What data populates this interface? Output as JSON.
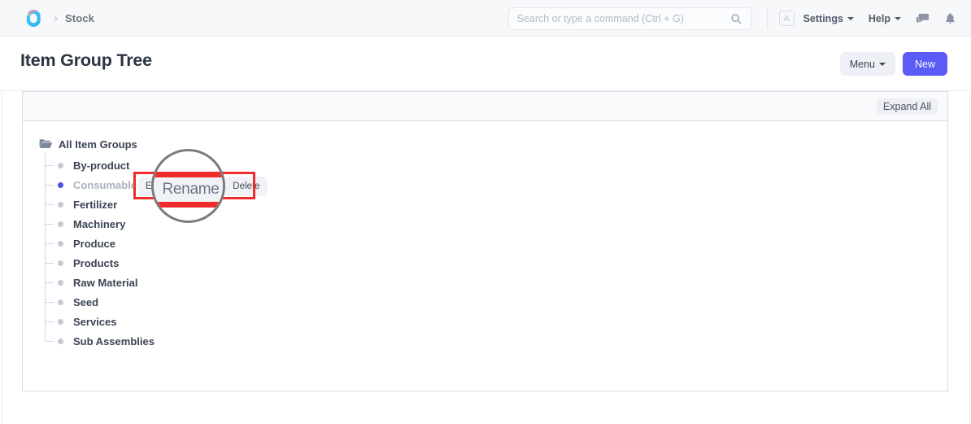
{
  "navbar": {
    "logo_icon": "stock-app-logo-icon",
    "breadcrumb_separator": "›",
    "breadcrumb": "Stock",
    "search": {
      "placeholder": "Search or type a command (Ctrl + G)",
      "value": "",
      "icon": "search-icon"
    },
    "avatar_initial": "A",
    "settings_label": "Settings",
    "help_label": "Help",
    "chat_icon": "comment-icon",
    "notifications_icon": "bell-icon"
  },
  "page_head": {
    "title": "Item Group Tree",
    "menu_label": "Menu",
    "new_label": "New"
  },
  "card": {
    "expand_all_label": "Expand All"
  },
  "tree": {
    "root": {
      "label": "All Item Groups",
      "icon": "open-folder-icon"
    },
    "nodes": [
      {
        "label": "By-product",
        "active": false
      },
      {
        "label": "Consumable",
        "active": true
      },
      {
        "label": "Fertilizer",
        "active": false
      },
      {
        "label": "Machinery",
        "active": false
      },
      {
        "label": "Produce",
        "active": false
      },
      {
        "label": "Products",
        "active": false
      },
      {
        "label": "Raw Material",
        "active": false
      },
      {
        "label": "Seed",
        "active": false
      },
      {
        "label": "Services",
        "active": false
      },
      {
        "label": "Sub Assemblies",
        "active": false
      }
    ]
  },
  "node_actions": {
    "edit_label": "Edit",
    "rename_label": "Rename",
    "delete_label": "Delete"
  },
  "annotation": {
    "magnified_label": "Rename",
    "highlight_color": "#ef2b2b",
    "magnifier_border_color": "#7b7b7b"
  }
}
